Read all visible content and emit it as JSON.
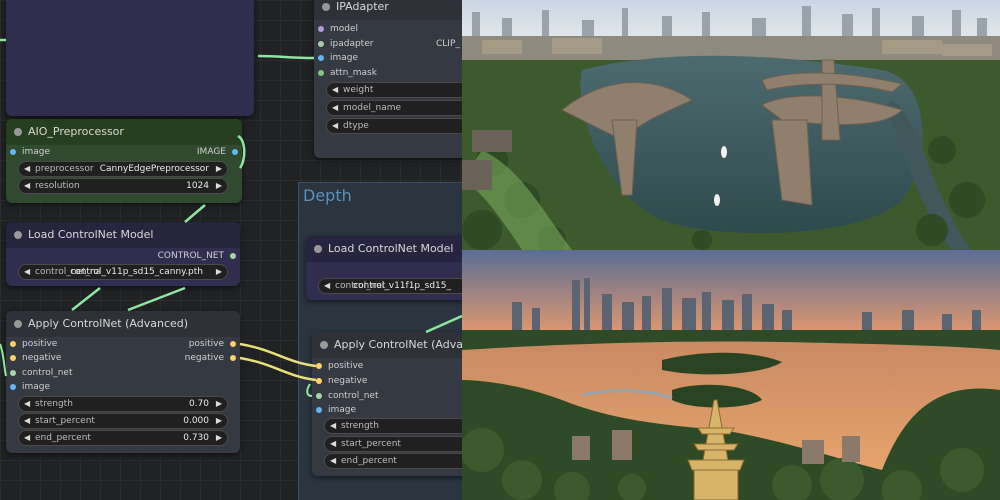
{
  "groups": {
    "depth": "Depth"
  },
  "nodes": {
    "ipadapter": {
      "title": "IPAdapter",
      "inputs": [
        "model",
        "ipadapter",
        "image",
        "attn_mask"
      ],
      "output": "CLIP_",
      "widgets": [
        "weight",
        "model_name",
        "dtype"
      ]
    },
    "aio": {
      "title": "AIO_Preprocessor",
      "input": "image",
      "output": "IMAGE",
      "widgets": [
        {
          "label": "preprocessor",
          "value": "CannyEdgePreprocessor"
        },
        {
          "label": "resolution",
          "value": "1024"
        }
      ]
    },
    "load_cn_1": {
      "title": "Load ControlNet Model",
      "output": "CONTROL_NET",
      "widget_label": "control_net_na",
      "widget_value": "control_v11p_sd15_canny.pth"
    },
    "apply_cn_1": {
      "title": "Apply ControlNet (Advanced)",
      "inputs": [
        "positive",
        "negative",
        "control_net",
        "image"
      ],
      "outputs": [
        "positive",
        "negative"
      ],
      "widgets": [
        {
          "label": "strength",
          "value": "0.70"
        },
        {
          "label": "start_percent",
          "value": "0.000"
        },
        {
          "label": "end_percent",
          "value": "0.730"
        }
      ]
    },
    "load_cn_2": {
      "title": "Load ControlNet Model",
      "widget_label": "control_net_",
      "widget_value": "control_v11f1p_sd15_"
    },
    "apply_cn_2": {
      "title": "Apply ControlNet (Advanced",
      "inputs": [
        "positive",
        "negative",
        "control_net",
        "image"
      ],
      "widgets": [
        "strength",
        "start_percent",
        "end_percent"
      ]
    }
  },
  "colors": {
    "slot_model": "#b39ddb",
    "slot_ipadapter": "#aaccaa",
    "slot_image": "#64b5f6",
    "slot_mask": "#81c784",
    "slot_conditioning": "#ffd166",
    "slot_controlnet": "#a5d6a7",
    "wire_green": "#8ee6a0",
    "wire_yellow": "#e8e07a"
  },
  "images": {
    "top": "aerial-view-futuristic-architecture-lake",
    "bottom": "sunset-city-skyline-river-pagoda"
  }
}
